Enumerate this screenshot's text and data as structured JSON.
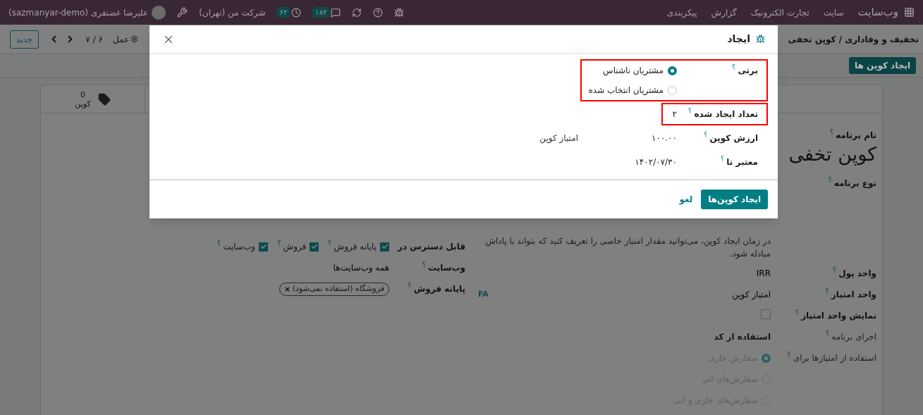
{
  "topbar": {
    "app_name": "وب‌سایت",
    "menu": [
      "سایت",
      "تجارت الکترونیک",
      "گزارش",
      "پیکربندی"
    ],
    "message_count": "۱۸۲",
    "activity_count": "۶۲",
    "company": "شرکت من (تهران)",
    "user": "علیرضا غضنفری (sazmanyar-demo)"
  },
  "control_panel": {
    "breadcrumb": "تخفیف و وفاداری / کوپن تخفی",
    "action": "عمل",
    "pager": "۶ / ۷",
    "new_button": "جدید"
  },
  "action_bar": {
    "button": "ایجاد کوپن ها"
  },
  "form": {
    "stat": {
      "count": "0",
      "label": "کوپن"
    },
    "name_label": "نام برنامه",
    "title": "کوپن تخفی",
    "type_label": "نوع برنامه",
    "help": "؟",
    "description": "در زمان ایجاد کوپن، می‌توانید مقدار امتیاز خاصی را تعریف کنید که بتواند با پاداش مبادله شود.",
    "right_fields": [
      {
        "kind": "text",
        "label": "واحد پول",
        "help": "؟",
        "value": "IRR"
      },
      {
        "kind": "text",
        "label": "واحد امتیاز",
        "help": "؟",
        "value": "امتیاز کوپن",
        "lang": "FA"
      },
      {
        "kind": "checkbox",
        "label": "نمایش واحد امتیاز",
        "help": "؟",
        "checked": false
      },
      {
        "kind": "readonly",
        "label": "اجرای برنامه",
        "help": "؟",
        "value": "استفاده از کد"
      },
      {
        "kind": "radio",
        "label": "استفاده از امتیازها برای",
        "help": "؟",
        "disabled": true,
        "options": [
          {
            "label": "سفارش جاری",
            "selected": true
          },
          {
            "label": "سفارش‌های آتی",
            "selected": false
          },
          {
            "label": "سفارش‌های جاری و آتی",
            "selected": false
          }
        ]
      }
    ],
    "left_fields": [
      {
        "kind": "checkboxes",
        "label": "قابل دسترس در",
        "options": [
          {
            "label": "پایانه فروش",
            "help": "؟",
            "checked": true
          },
          {
            "label": "فروش",
            "help": "؟",
            "checked": true
          },
          {
            "label": "وب‌سایت",
            "help": "؟",
            "checked": true
          }
        ]
      },
      {
        "kind": "text",
        "label": "وب‌سایت",
        "help": "؟",
        "value": "همه وب‌سایت‌ها"
      },
      {
        "kind": "tags",
        "label": "پایانه فروش",
        "help": "؟",
        "tags": [
          "فروشگاه (استفاده نمی‌شود)"
        ]
      }
    ]
  },
  "dialog": {
    "title": "ایجاد",
    "fields": [
      {
        "kind": "radio",
        "label": "برتی",
        "help": "؟",
        "highlighted": true,
        "options": [
          {
            "label": "مشتریان ناشناس",
            "selected": true
          },
          {
            "label": "مشتریان انتخاب شده",
            "selected": false
          }
        ]
      },
      {
        "kind": "text",
        "label": "تعداد ایجاد شده",
        "help": "؟",
        "value": "۲",
        "highlighted": true
      },
      {
        "kind": "text",
        "label": "ارزش کوپن",
        "help": "؟",
        "value": "۱۰۰.۰۰",
        "unit": "امتیاز کوپن",
        "highlighted": false
      },
      {
        "kind": "text",
        "label": "معتبر تا",
        "help": "؟",
        "value": "۱۴۰۲/۰۷/۳۰",
        "highlighted": false
      }
    ],
    "buttons": [
      {
        "label": "ایجاد کوپن‌ها",
        "primary": true
      },
      {
        "label": "لغو",
        "primary": false
      }
    ]
  }
}
